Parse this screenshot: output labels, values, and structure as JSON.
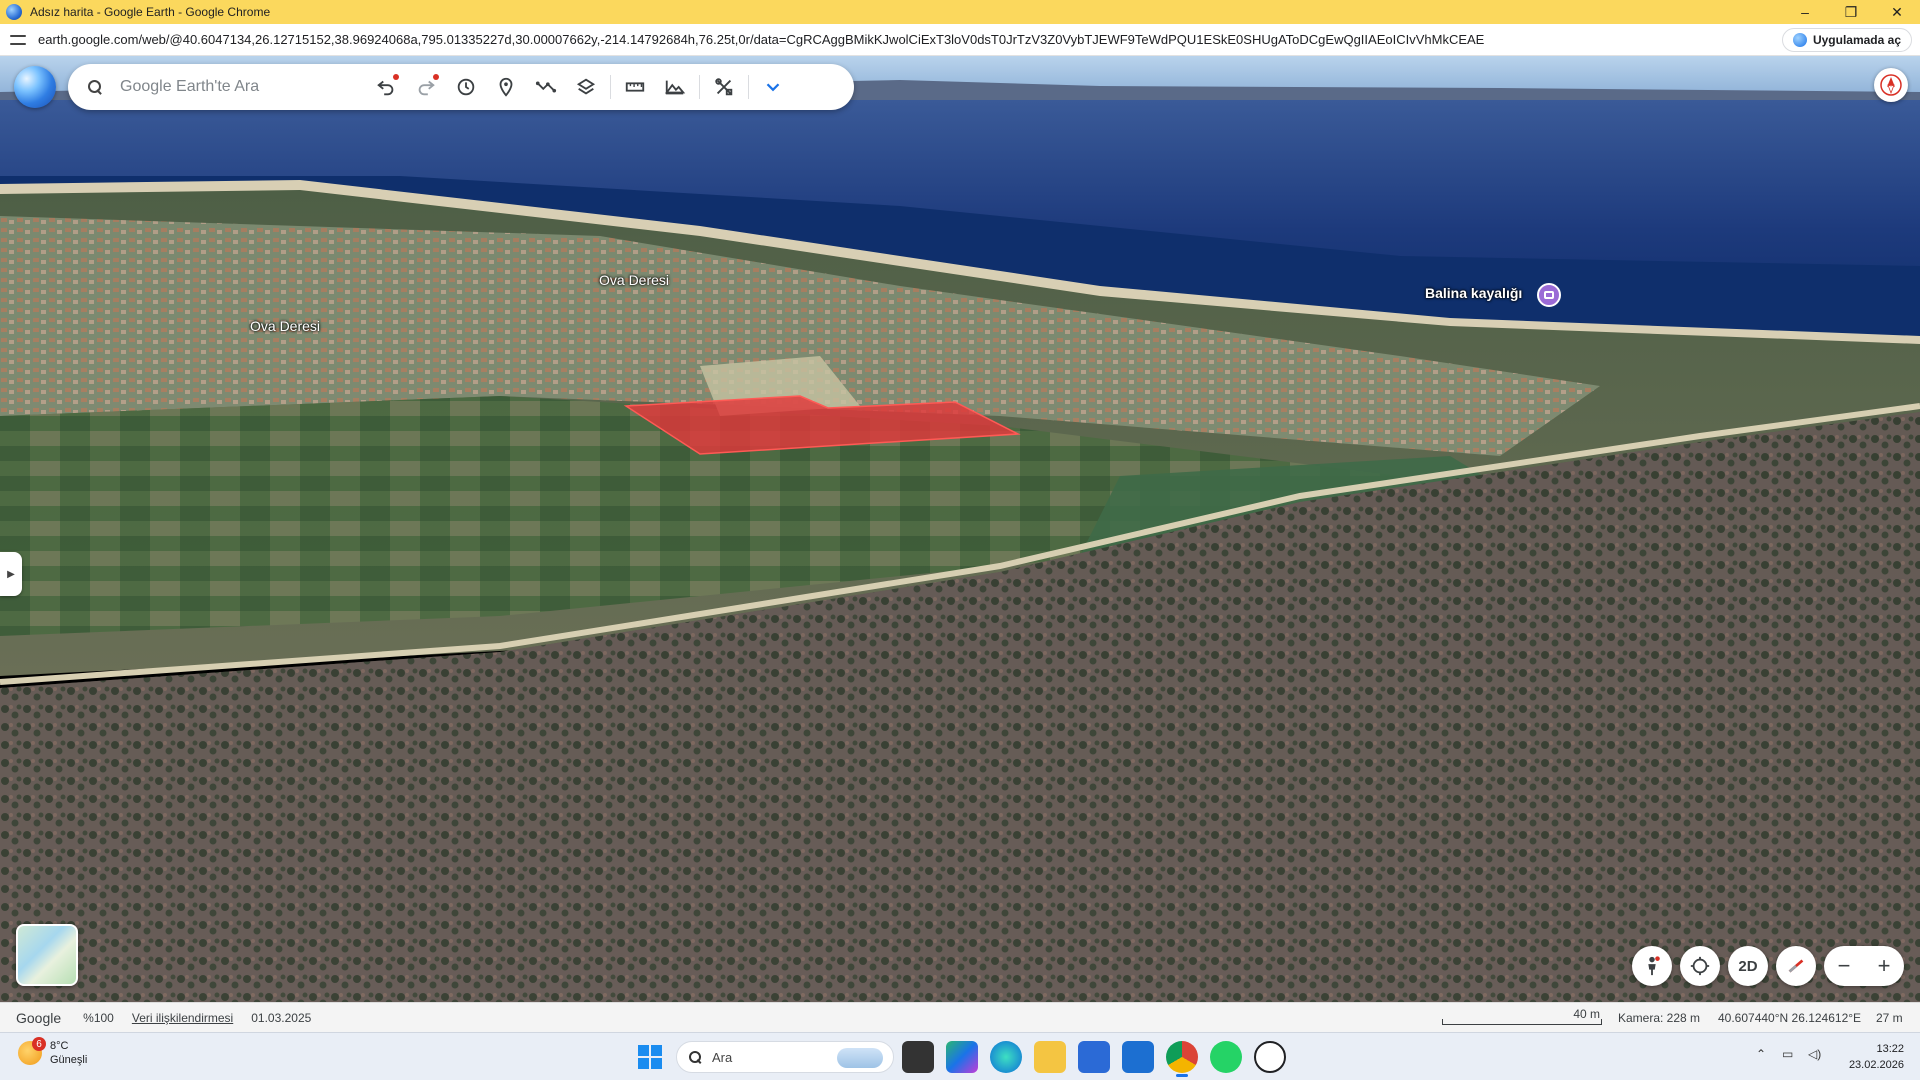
{
  "window": {
    "title": "Adsız harita - Google Earth - Google Chrome",
    "controls": [
      "–",
      "❐",
      "✕"
    ]
  },
  "browser": {
    "url": "earth.google.com/web/@40.6047134,26.12715152,38.96924068a,795.01335227d,30.00007662y,-214.14792684h,76.25t,0r/data=CgRCAggBMikKJwolCiExT3loV0dsT0JrTzV3Z0VybTJEWF9TeWdPQU1ESkE0SHUgAToDCgEwQgIIAEoICIvVhMkCEAE",
    "open_in_app": "Uygulamada aç"
  },
  "search": {
    "placeholder": "Google Earth'te Ara"
  },
  "toolbar": {
    "icons": [
      "undo-icon",
      "redo-icon",
      "history-icon",
      "placemark-icon",
      "path-icon",
      "layers-icon",
      "ruler-icon",
      "image-overlay-icon",
      "tools-icon",
      "chevron-down-icon"
    ]
  },
  "map": {
    "labels": {
      "ova_deresi_1": "Ova Deresi",
      "ova_deresi_2": "Ova Deresi",
      "poi": "Balina kayalığı"
    },
    "highlight_color": "#e0383a"
  },
  "controls": {
    "mode_2d": "2D"
  },
  "status": {
    "brand": "Google",
    "zoom": "%100",
    "attribution": "Veri ilişkilendirmesi",
    "date": "01.03.2025",
    "scale": "40 m",
    "camera": "Kamera: 228 m",
    "coords": "40.607440°N 26.124612°E",
    "elevation": "27 m"
  },
  "taskbar": {
    "weather_temp": "8°C",
    "weather_desc": "Güneşli",
    "weather_badge": "6",
    "search_placeholder": "Ara",
    "time": "13:22",
    "date": "23.02.2026"
  }
}
